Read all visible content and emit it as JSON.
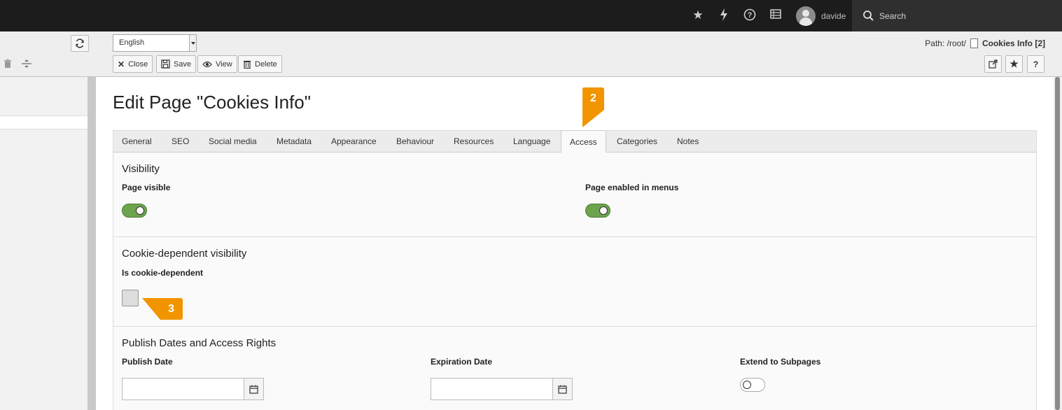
{
  "topbar": {
    "icons": [
      "star-icon",
      "bolt-icon",
      "help-icon",
      "list-icon"
    ],
    "username": "davide",
    "search_placeholder": "Search"
  },
  "docheader": {
    "language": "English",
    "path_prefix": "Path: /root/",
    "path_page": "Cookies Info [2]",
    "buttons": {
      "close": "Close",
      "save": "Save",
      "view": "View",
      "delete": "Delete"
    },
    "help_label": "?"
  },
  "page": {
    "title": "Edit Page \"Cookies Info\""
  },
  "tabs": [
    {
      "label": "General"
    },
    {
      "label": "SEO"
    },
    {
      "label": "Social media"
    },
    {
      "label": "Metadata"
    },
    {
      "label": "Appearance"
    },
    {
      "label": "Behaviour"
    },
    {
      "label": "Resources"
    },
    {
      "label": "Language"
    },
    {
      "label": "Access",
      "active": true
    },
    {
      "label": "Categories"
    },
    {
      "label": "Notes"
    }
  ],
  "visibility": {
    "title": "Visibility",
    "page_visible_label": "Page visible",
    "page_visible": true,
    "enabled_in_menus_label": "Page enabled in menus",
    "enabled_in_menus": true
  },
  "cookie": {
    "title": "Cookie-dependent visibility",
    "is_cookie_dependent_label": "Is cookie-dependent",
    "is_cookie_dependent": false
  },
  "publish": {
    "title": "Publish Dates and Access Rights",
    "publish_date_label": "Publish Date",
    "publish_date_value": "",
    "expiration_date_label": "Expiration Date",
    "expiration_date_value": "",
    "extend_label": "Extend to Subpages",
    "extend": false
  },
  "badges": {
    "step2": "2",
    "step3": "3",
    "color": "#f29400"
  }
}
